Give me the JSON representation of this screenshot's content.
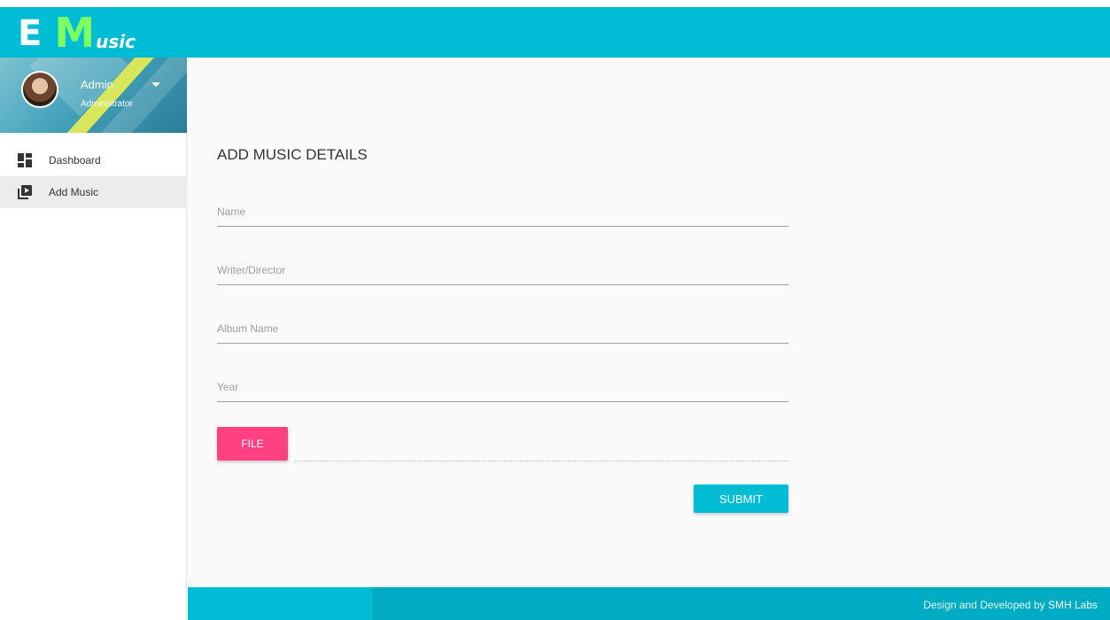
{
  "brand": {
    "letter_e": "E",
    "letter_m": "M",
    "letters_rest": "usic"
  },
  "user": {
    "name": "Admin",
    "role": "Administrator"
  },
  "nav": {
    "items": [
      {
        "label": "Dashboard",
        "icon": "dashboard-icon",
        "active": false
      },
      {
        "label": "Add Music",
        "icon": "video-library-icon",
        "active": true
      }
    ]
  },
  "form": {
    "title": "ADD MUSIC DETAILS",
    "fields": [
      {
        "placeholder": "Name",
        "value": ""
      },
      {
        "placeholder": "Writer/Director",
        "value": ""
      },
      {
        "placeholder": "Album Name",
        "value": ""
      },
      {
        "placeholder": "Year",
        "value": ""
      }
    ],
    "file_label": "FILE",
    "submit_label": "SUBMIT"
  },
  "footer": {
    "credit_prefix": "Design and Developed by",
    "credit_brand": "SMH Labs"
  },
  "colors": {
    "primary": "#00bcd4",
    "accent": "#ff4081",
    "logo_green": "#7dff62"
  }
}
